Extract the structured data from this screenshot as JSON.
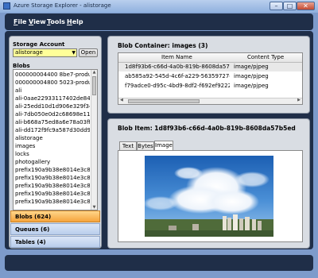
{
  "window": {
    "title": "Azure Storage Explorer - alistorage",
    "minimize": "–",
    "maximize": "□",
    "close": "✕"
  },
  "menu": {
    "items": [
      {
        "accel": "F",
        "rest": "ile"
      },
      {
        "accel": "V",
        "rest": "iew"
      },
      {
        "accel": "T",
        "rest": "ools"
      },
      {
        "accel": "H",
        "rest": "elp"
      }
    ]
  },
  "left": {
    "storage_label": "Storage Account",
    "storage_value": "alistorage",
    "open_button": "Open",
    "blobs_label": "Blobs",
    "blob_items": [
      "000000004400 8be7-producti",
      "000000004800 5023-producti",
      "ali",
      "ali-0aae22933117402de8440",
      "ali-25edd10d1d906e329f34",
      "ali-7db050e0d2c68698e115t",
      "ali-b668a75ed8a6e78a03ff9f",
      "ali-dd172f9fc9a587d30dd9a9",
      "alistorage",
      "images",
      "locks",
      "photogallery",
      "prefix190a9b38e8014e3c828",
      "prefix190a9b38e8014e3c828",
      "prefix190a9b38e8014e3c828",
      "prefix190a9b38e8014e3c828",
      "prefix190a9b38e8014e3c828"
    ],
    "sections": [
      {
        "label": "Blobs (624)",
        "active": true
      },
      {
        "label": "Queues (6)",
        "active": false
      },
      {
        "label": "Tables (4)",
        "active": false
      }
    ]
  },
  "container": {
    "title": "Blob Container: images (3)",
    "columns": [
      "Item Name",
      "Content Type"
    ],
    "rows": [
      {
        "name": "1d8f93b6-c66d-4a0b-819b-8608da57b5",
        "type": "image/pjpeg"
      },
      {
        "name": "ab585a92-545d-4c6f-a229-56359727c8:",
        "type": "image/pjpeg"
      },
      {
        "name": "f79adce0-d95c-4bd9-8df2-f692ef92225:",
        "type": "image/pjpeg"
      }
    ]
  },
  "item": {
    "title": "Blob Item: 1d8f93b6-c66d-4a0b-819b-8608da57b5ed",
    "tabs": [
      "Text",
      "Bytes",
      "Image"
    ],
    "active_tab": "Image"
  }
}
